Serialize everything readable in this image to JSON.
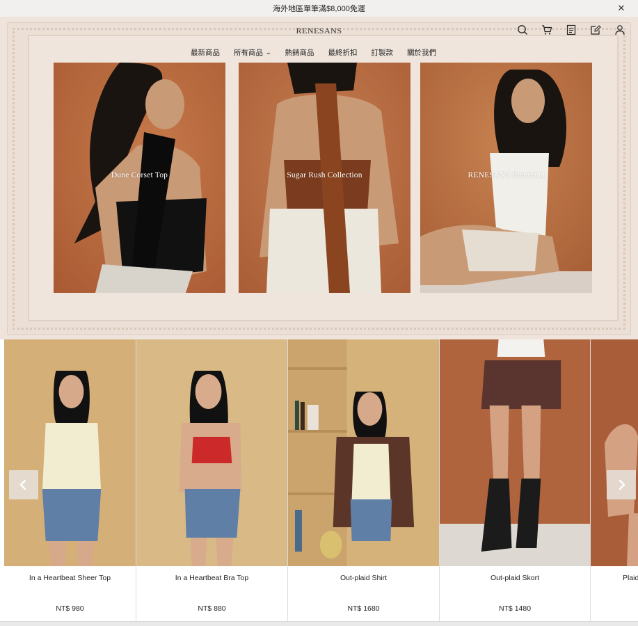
{
  "announcement": {
    "text": "海外地區單筆滿$8,000免運",
    "close_icon": "close-icon"
  },
  "brand": {
    "name": "RENESANS"
  },
  "header_icons": [
    "search-icon",
    "cart-icon",
    "order-list-icon",
    "edit-icon",
    "account-icon"
  ],
  "nav": {
    "items": [
      {
        "label": "最新商品"
      },
      {
        "label": "所有商品",
        "has_dropdown": true
      },
      {
        "label": "熱銷商品"
      },
      {
        "label": "最終折扣"
      },
      {
        "label": "訂製款"
      },
      {
        "label": "關於我們"
      }
    ]
  },
  "hero": {
    "cards": [
      {
        "title": "Dune Corset Top"
      },
      {
        "title": "Sugar Rush Collection"
      },
      {
        "title": "RENESANS Prensents"
      }
    ]
  },
  "products": [
    {
      "name": "In a Heartbeat Sheer Top",
      "price": "NT$ 980"
    },
    {
      "name": "In a Heartbeat Bra Top",
      "price": "NT$ 880"
    },
    {
      "name": "Out-plaid Shirt",
      "price": "NT$ 1680"
    },
    {
      "name": "Out-plaid Skort",
      "price": "NT$ 1480"
    },
    {
      "name": "Plaid",
      "price": ""
    }
  ],
  "colors": {
    "accent_terracotta": "#b9693f",
    "frame_bg": "#eee4dc",
    "announce_bg": "#f1f0ee"
  }
}
